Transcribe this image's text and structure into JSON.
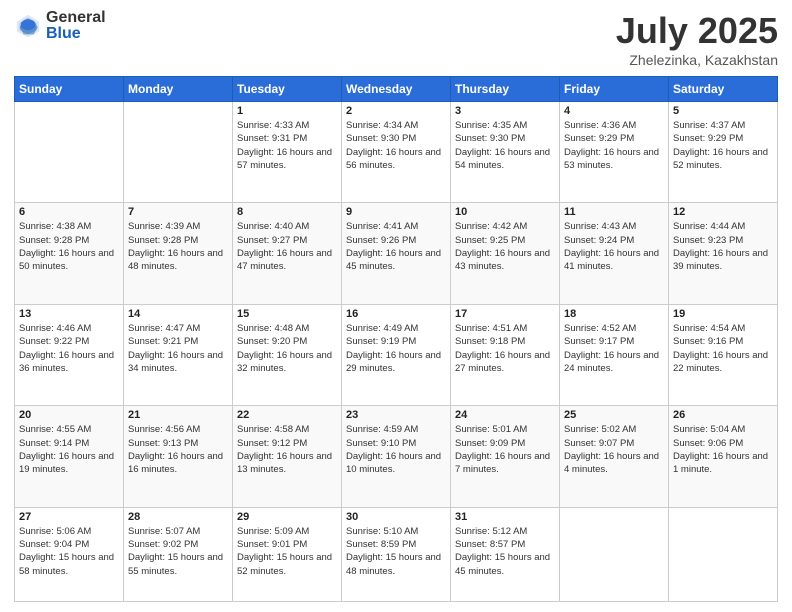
{
  "header": {
    "logo_general": "General",
    "logo_blue": "Blue",
    "title": "July 2025",
    "subtitle": "Zhelezinka, Kazakhstan"
  },
  "days_of_week": [
    "Sunday",
    "Monday",
    "Tuesday",
    "Wednesday",
    "Thursday",
    "Friday",
    "Saturday"
  ],
  "weeks": [
    [
      {
        "day": "",
        "info": ""
      },
      {
        "day": "",
        "info": ""
      },
      {
        "day": "1",
        "info": "Sunrise: 4:33 AM\nSunset: 9:31 PM\nDaylight: 16 hours and 57 minutes."
      },
      {
        "day": "2",
        "info": "Sunrise: 4:34 AM\nSunset: 9:30 PM\nDaylight: 16 hours and 56 minutes."
      },
      {
        "day": "3",
        "info": "Sunrise: 4:35 AM\nSunset: 9:30 PM\nDaylight: 16 hours and 54 minutes."
      },
      {
        "day": "4",
        "info": "Sunrise: 4:36 AM\nSunset: 9:29 PM\nDaylight: 16 hours and 53 minutes."
      },
      {
        "day": "5",
        "info": "Sunrise: 4:37 AM\nSunset: 9:29 PM\nDaylight: 16 hours and 52 minutes."
      }
    ],
    [
      {
        "day": "6",
        "info": "Sunrise: 4:38 AM\nSunset: 9:28 PM\nDaylight: 16 hours and 50 minutes."
      },
      {
        "day": "7",
        "info": "Sunrise: 4:39 AM\nSunset: 9:28 PM\nDaylight: 16 hours and 48 minutes."
      },
      {
        "day": "8",
        "info": "Sunrise: 4:40 AM\nSunset: 9:27 PM\nDaylight: 16 hours and 47 minutes."
      },
      {
        "day": "9",
        "info": "Sunrise: 4:41 AM\nSunset: 9:26 PM\nDaylight: 16 hours and 45 minutes."
      },
      {
        "day": "10",
        "info": "Sunrise: 4:42 AM\nSunset: 9:25 PM\nDaylight: 16 hours and 43 minutes."
      },
      {
        "day": "11",
        "info": "Sunrise: 4:43 AM\nSunset: 9:24 PM\nDaylight: 16 hours and 41 minutes."
      },
      {
        "day": "12",
        "info": "Sunrise: 4:44 AM\nSunset: 9:23 PM\nDaylight: 16 hours and 39 minutes."
      }
    ],
    [
      {
        "day": "13",
        "info": "Sunrise: 4:46 AM\nSunset: 9:22 PM\nDaylight: 16 hours and 36 minutes."
      },
      {
        "day": "14",
        "info": "Sunrise: 4:47 AM\nSunset: 9:21 PM\nDaylight: 16 hours and 34 minutes."
      },
      {
        "day": "15",
        "info": "Sunrise: 4:48 AM\nSunset: 9:20 PM\nDaylight: 16 hours and 32 minutes."
      },
      {
        "day": "16",
        "info": "Sunrise: 4:49 AM\nSunset: 9:19 PM\nDaylight: 16 hours and 29 minutes."
      },
      {
        "day": "17",
        "info": "Sunrise: 4:51 AM\nSunset: 9:18 PM\nDaylight: 16 hours and 27 minutes."
      },
      {
        "day": "18",
        "info": "Sunrise: 4:52 AM\nSunset: 9:17 PM\nDaylight: 16 hours and 24 minutes."
      },
      {
        "day": "19",
        "info": "Sunrise: 4:54 AM\nSunset: 9:16 PM\nDaylight: 16 hours and 22 minutes."
      }
    ],
    [
      {
        "day": "20",
        "info": "Sunrise: 4:55 AM\nSunset: 9:14 PM\nDaylight: 16 hours and 19 minutes."
      },
      {
        "day": "21",
        "info": "Sunrise: 4:56 AM\nSunset: 9:13 PM\nDaylight: 16 hours and 16 minutes."
      },
      {
        "day": "22",
        "info": "Sunrise: 4:58 AM\nSunset: 9:12 PM\nDaylight: 16 hours and 13 minutes."
      },
      {
        "day": "23",
        "info": "Sunrise: 4:59 AM\nSunset: 9:10 PM\nDaylight: 16 hours and 10 minutes."
      },
      {
        "day": "24",
        "info": "Sunrise: 5:01 AM\nSunset: 9:09 PM\nDaylight: 16 hours and 7 minutes."
      },
      {
        "day": "25",
        "info": "Sunrise: 5:02 AM\nSunset: 9:07 PM\nDaylight: 16 hours and 4 minutes."
      },
      {
        "day": "26",
        "info": "Sunrise: 5:04 AM\nSunset: 9:06 PM\nDaylight: 16 hours and 1 minute."
      }
    ],
    [
      {
        "day": "27",
        "info": "Sunrise: 5:06 AM\nSunset: 9:04 PM\nDaylight: 15 hours and 58 minutes."
      },
      {
        "day": "28",
        "info": "Sunrise: 5:07 AM\nSunset: 9:02 PM\nDaylight: 15 hours and 55 minutes."
      },
      {
        "day": "29",
        "info": "Sunrise: 5:09 AM\nSunset: 9:01 PM\nDaylight: 15 hours and 52 minutes."
      },
      {
        "day": "30",
        "info": "Sunrise: 5:10 AM\nSunset: 8:59 PM\nDaylight: 15 hours and 48 minutes."
      },
      {
        "day": "31",
        "info": "Sunrise: 5:12 AM\nSunset: 8:57 PM\nDaylight: 15 hours and 45 minutes."
      },
      {
        "day": "",
        "info": ""
      },
      {
        "day": "",
        "info": ""
      }
    ]
  ]
}
